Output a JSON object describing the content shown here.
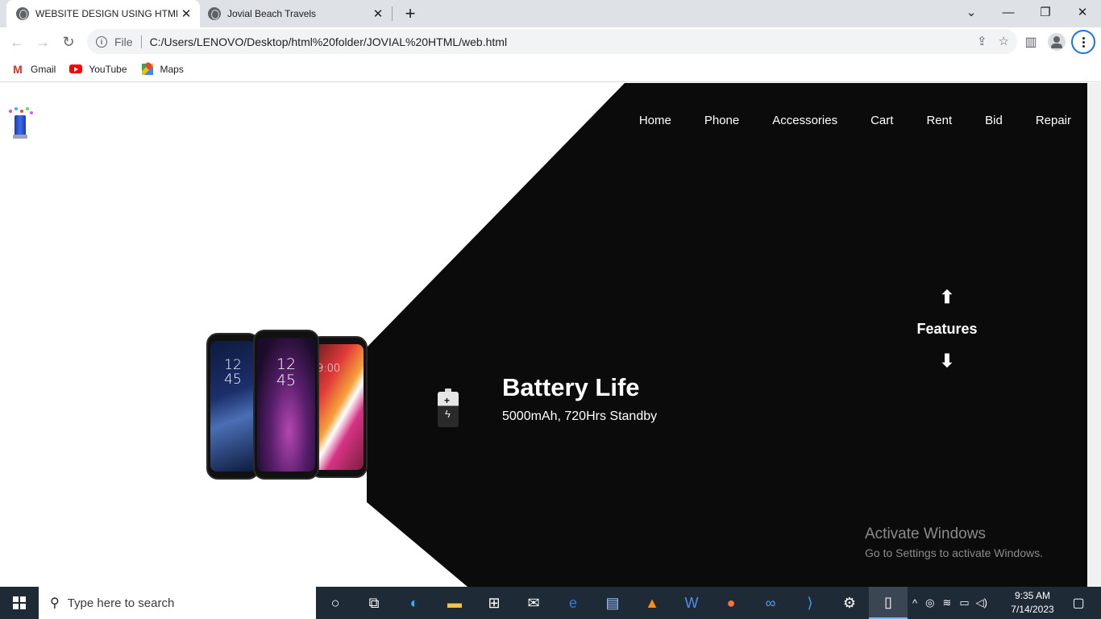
{
  "browser": {
    "tabs": [
      {
        "title": "WEBSITE DESIGN USING HTML A",
        "active": true
      },
      {
        "title": "Jovial Beach Travels",
        "active": false
      }
    ],
    "address": {
      "scheme_label": "File",
      "url": "C:/Users/LENOVO/Desktop/html%20folder/JOVIAL%20HTML/web.html"
    },
    "bookmarks": [
      {
        "label": "Gmail",
        "icon": "gmail-icon"
      },
      {
        "label": "YouTube",
        "icon": "youtube-icon"
      },
      {
        "label": "Maps",
        "icon": "maps-icon"
      }
    ]
  },
  "page": {
    "nav": [
      "Home",
      "Phone",
      "Accessories",
      "Cart",
      "Rent",
      "Bid",
      "Repair"
    ],
    "phones": [
      {
        "time_h": "12",
        "time_m": "45"
      },
      {
        "time_h": "12",
        "time_m": "45"
      },
      {
        "time": "9:00"
      }
    ],
    "feature": {
      "title": "Battery Life",
      "subtitle": "5000mAh, 720Hrs Standby",
      "icon": "battery-charging-icon"
    },
    "features_nav": {
      "label": "Features",
      "up_arrow": "⬆",
      "down_arrow": "⬇"
    },
    "colors": {
      "panel": "#0b0b0c",
      "text": "#ffffff"
    }
  },
  "watermark": {
    "line1": "Activate Windows",
    "line2": "Go to Settings to activate Windows."
  },
  "taskbar": {
    "search_placeholder": "Type here to search",
    "time": "9:35 AM",
    "date": "7/14/2023"
  }
}
